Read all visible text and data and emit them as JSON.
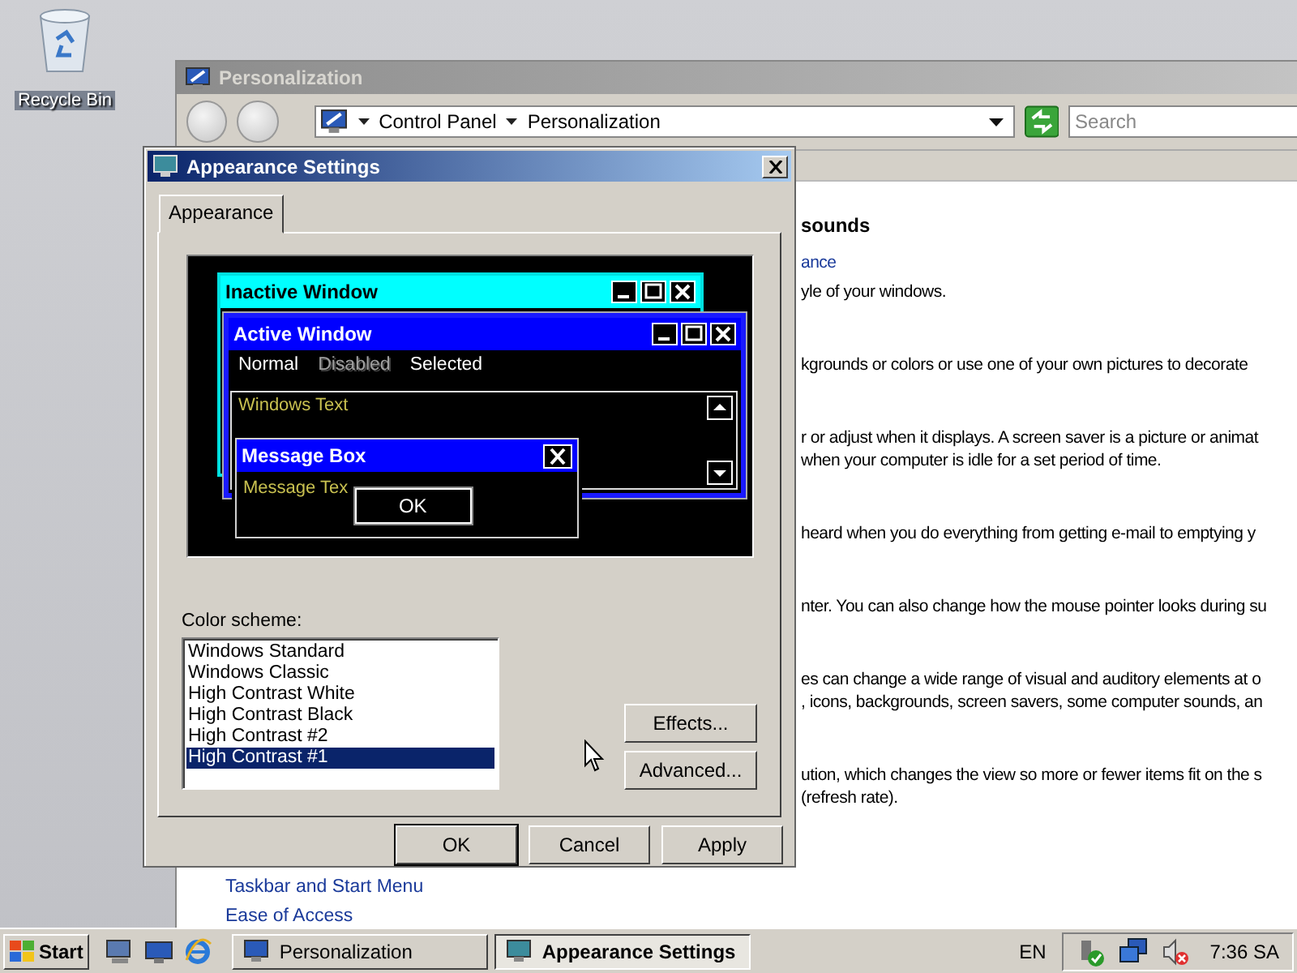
{
  "desktop": {
    "icons": [
      {
        "label": "Recycle Bin"
      }
    ]
  },
  "explorer": {
    "title": "Personalization",
    "breadcrumb": [
      "Control Panel",
      "Personalization"
    ],
    "search": {
      "placeholder": "Search"
    },
    "heading": "sounds",
    "sections": [
      {
        "link": "ance",
        "lines": [
          "yle of your windows."
        ]
      },
      {
        "lines": [
          "kgrounds or colors or use one of your own pictures to decorate"
        ]
      },
      {
        "lines": [
          "r or adjust when it displays. A screen saver is a picture or animat",
          "when your computer is idle for a set period of time."
        ]
      },
      {
        "lines": [
          "heard when you do everything from getting e-mail to emptying y"
        ]
      },
      {
        "lines": [
          "nter. You can also change how the mouse pointer looks during su"
        ]
      },
      {
        "lines": [
          "es can change a wide range of visual and auditory elements at o",
          ", icons, backgrounds, screen savers, some computer sounds, an"
        ]
      },
      {
        "lines": [
          "ution, which changes the view so more or fewer items fit on the s",
          "(refresh rate)."
        ]
      }
    ],
    "sidebar_links": [
      "Taskbar and Start Menu",
      "Ease of Access"
    ]
  },
  "dialog": {
    "title": "Appearance Settings",
    "tabs": [
      {
        "label": "Appearance",
        "selected": true
      }
    ],
    "preview": {
      "inactive_title": "Inactive Window",
      "active_title": "Active Window",
      "menu": [
        {
          "label": "Normal",
          "disabled": false
        },
        {
          "label": "Disabled",
          "disabled": true
        },
        {
          "label": "Selected",
          "disabled": false
        }
      ],
      "window_text": "Windows Text",
      "message_title": "Message Box",
      "message_text": "Message Tex",
      "message_button": "OK"
    },
    "color_scheme": {
      "label": "Color scheme:",
      "items": [
        {
          "label": "Windows Standard",
          "selected": false
        },
        {
          "label": "Windows Classic",
          "selected": false
        },
        {
          "label": "High Contrast White",
          "selected": false
        },
        {
          "label": "High Contrast Black",
          "selected": false
        },
        {
          "label": "High Contrast #2",
          "selected": false
        },
        {
          "label": "High Contrast #1",
          "selected": true
        }
      ]
    },
    "side_buttons": [
      "Effects...",
      "Advanced..."
    ],
    "buttons": [
      {
        "label": "OK",
        "default": true
      },
      {
        "label": "Cancel",
        "default": false
      },
      {
        "label": "Apply",
        "default": false
      }
    ]
  },
  "taskbar": {
    "start": "Start",
    "tasks": [
      {
        "label": "Personalization",
        "selected": false
      },
      {
        "label": "Appearance Settings",
        "selected": true
      }
    ],
    "language": "EN",
    "clock": "7:36 SA"
  }
}
